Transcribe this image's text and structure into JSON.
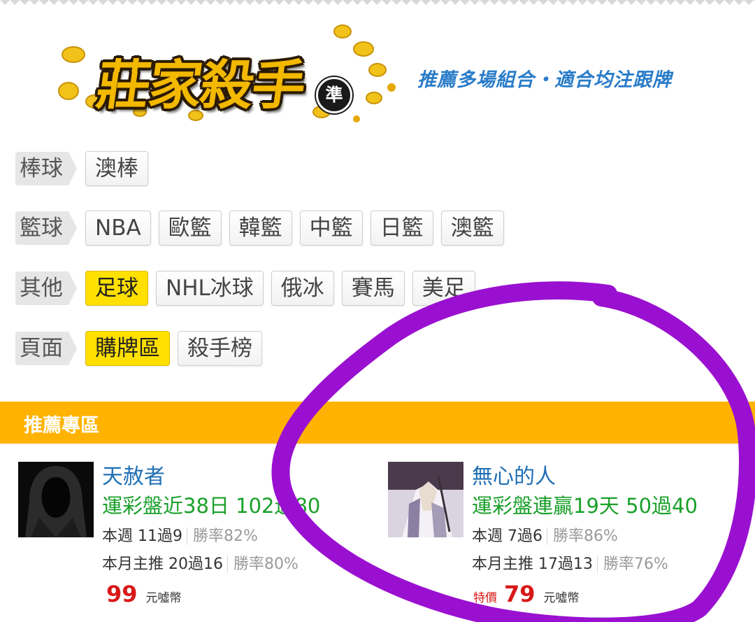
{
  "header": {
    "logo_text": "莊家殺手",
    "logo_badge": "準",
    "tagline": "推薦多場組合・適合均注跟牌"
  },
  "filters": [
    {
      "label": "棒球",
      "chips": [
        {
          "text": "澳棒",
          "active": false
        }
      ]
    },
    {
      "label": "籃球",
      "chips": [
        {
          "text": "NBA",
          "active": false
        },
        {
          "text": "歐籃",
          "active": false
        },
        {
          "text": "韓籃",
          "active": false
        },
        {
          "text": "中籃",
          "active": false
        },
        {
          "text": "日籃",
          "active": false
        },
        {
          "text": "澳籃",
          "active": false
        }
      ]
    },
    {
      "label": "其他",
      "chips": [
        {
          "text": "足球",
          "active": true
        },
        {
          "text": "NHL冰球",
          "active": false
        },
        {
          "text": "俄冰",
          "active": false
        },
        {
          "text": "賽馬",
          "active": false
        },
        {
          "text": "美足",
          "active": false
        }
      ]
    },
    {
      "label": "頁面",
      "chips": [
        {
          "text": "購牌區",
          "active": true
        },
        {
          "text": "殺手榜",
          "active": false
        }
      ]
    }
  ],
  "section": {
    "title": "推薦專區"
  },
  "cards": [
    {
      "name": "天赦者",
      "record": "運彩盤近38日 102過80",
      "week": "本週 11過9",
      "week_rate": "勝率82%",
      "month": "本月主推 20過16",
      "month_rate": "勝率80%",
      "price_special": "",
      "price": "99",
      "unit": "元噓幣"
    },
    {
      "name": "無心的人",
      "record": "運彩盤連贏19天 50過40",
      "week": "本週 7過6",
      "week_rate": "勝率86%",
      "month": "本月主推 17過13",
      "month_rate": "勝率76%",
      "price_special": "特價",
      "price": "79",
      "unit": "元噓幣"
    }
  ],
  "colors": {
    "accent_orange": "#ffb300",
    "active_chip": "#ffe000",
    "name_blue": "#1f6fb5",
    "record_green": "#1aa02a",
    "price_red": "#d81818",
    "annotation_purple": "#9a10d0"
  }
}
